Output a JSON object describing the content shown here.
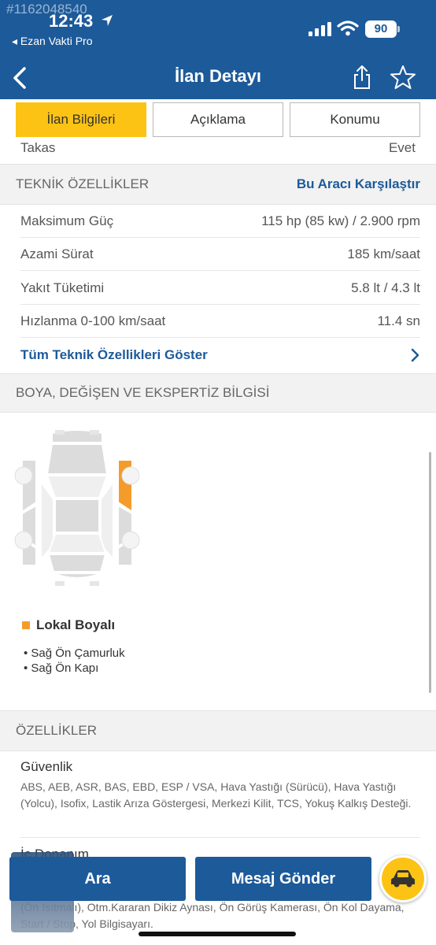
{
  "status_bar": {
    "watermark": "#1162048540",
    "time": "12:43",
    "back_app": "◂ Ezan Vakti Pro",
    "battery": "90"
  },
  "header": {
    "title": "İlan Detayı",
    "icons": [
      "back-chevron-icon",
      "share-icon",
      "star-icon"
    ]
  },
  "tabs": [
    {
      "label": "İlan Bilgileri",
      "active": true
    },
    {
      "label": "Açıklama",
      "active": false
    },
    {
      "label": "Konumu",
      "active": false
    }
  ],
  "takas": {
    "label": "Takas",
    "value": "Evet"
  },
  "technical": {
    "heading": "TEKNİK ÖZELLİKLER",
    "compare_link": "Bu Aracı Karşılaştır",
    "rows": [
      {
        "label": "Maksimum Güç",
        "value": "115 hp (85 kw) / 2.900 rpm"
      },
      {
        "label": "Azami Sürat",
        "value": "185 km/saat"
      },
      {
        "label": "Yakıt Tüketimi",
        "value": "5.8 lt / 4.3 lt"
      },
      {
        "label": "Hızlanma 0-100 km/saat",
        "value": "11.4 sn"
      }
    ],
    "show_all": "Tüm Teknik Özellikleri Göster"
  },
  "paint": {
    "heading": "BOYA, DEĞİŞEN VE EKSPERTİZ BİLGİSİ",
    "legend_label": "Lokal Boyalı",
    "legend_color": "#f39c2b",
    "parts": [
      "• Sağ Ön Çamurluk",
      "• Sağ Ön Kapı"
    ]
  },
  "features": {
    "heading": "ÖZELLİKLER",
    "groups": [
      {
        "title": "Güvenlik",
        "text": "ABS, AEB, ASR, BAS, EBD, ESP / VSA, Hava Yastığı (Sürücü), Hava Yastığı (Yolcu), Isofix, Lastik Arıza Göstergesi, Merkezi Kilit, TCS, Yokuş Kalkış Desteği."
      },
      {
        "title": "İç Donanım",
        "text": "(Ön Isıtmalı), Otm.Kararan Dikiz Aynası, Ön Görüş Kamerası, Ön Kol Dayama, Start / Stop, Yol Bilgisayarı."
      }
    ]
  },
  "actions": {
    "call": "Ara",
    "message": "Mesaj Gönder"
  },
  "colors": {
    "primary": "#1d5a9a",
    "accent": "#fcc314"
  }
}
